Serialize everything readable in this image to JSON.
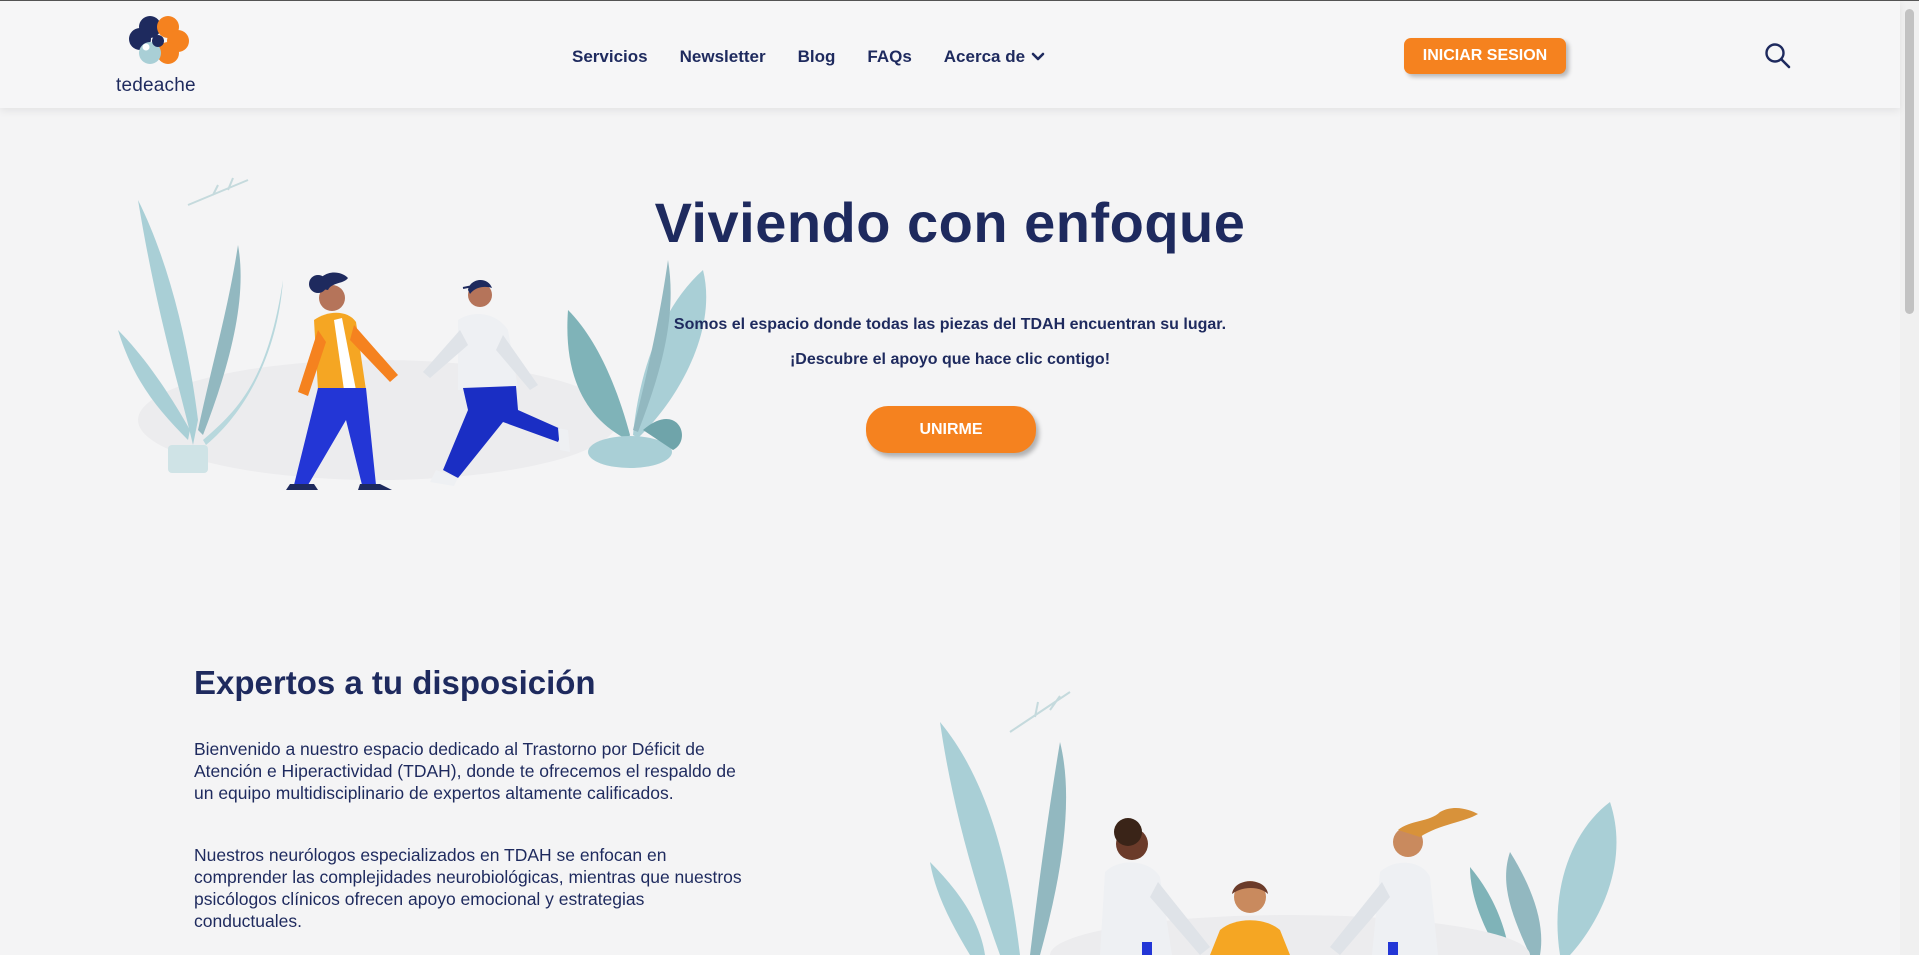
{
  "brand": {
    "name": "tedeache"
  },
  "nav": {
    "items": [
      {
        "label": "Servicios"
      },
      {
        "label": "Newsletter"
      },
      {
        "label": "Blog"
      },
      {
        "label": "FAQs"
      },
      {
        "label": "Acerca de",
        "icon": "chevron-down-icon"
      }
    ],
    "login_label": "INICIAR SESION",
    "search_icon": "search-icon"
  },
  "hero": {
    "title": "Viviendo con enfoque",
    "subtitle_1": "Somos el espacio donde todas las piezas del TDAH encuentran su lugar.",
    "subtitle_2": "¡Descubre el apoyo que hace clic contigo!",
    "cta_label": "UNIRME"
  },
  "experts": {
    "title": "Expertos a tu disposición",
    "paragraph_1": "Bienvenido a nuestro espacio dedicado al Trastorno por Déficit de Atención e Hiperactividad (TDAH), donde te ofrecemos el respaldo de un equipo multidisciplinario de expertos altamente calificados.",
    "paragraph_2": "Nuestros neurólogos especializados en TDAH se enfocan en comprender las complejidades neurobiológicas, mientras que nuestros psicólogos clínicos ofrecen apoyo emocional y estrategias conductuales.",
    "paragraph_3": ""
  },
  "colors": {
    "navy": "#1e2a5e",
    "orange": "#f5821f",
    "background": "#f4f4f5",
    "leaf": "#a9cfd6",
    "blue_pants": "#2336d6"
  }
}
